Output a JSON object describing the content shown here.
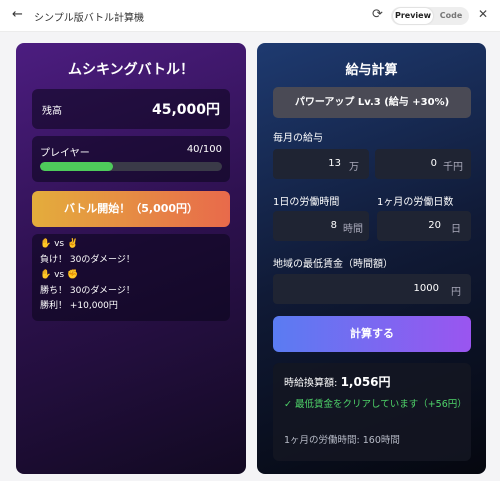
{
  "topbar": {
    "back_icon": "←",
    "title": "シンプル版バトル計算機",
    "refresh_icon": "⟳",
    "toggle": {
      "preview": "Preview",
      "code": "Code"
    },
    "close_icon": "✕"
  },
  "battle": {
    "title": "ムシキングバトル！",
    "balance_label": "残高",
    "balance_value": "45,000円",
    "player_label": "プレイヤー",
    "player_hp": "40/100",
    "player_hp_fraction": 0.4,
    "hp_bar_color": "#4ecb5b",
    "start_button": "バトル開始！（5,000円）",
    "log": [
      "✋ vs ✌️",
      "負け！ 30のダメージ！",
      "✋ vs ✊",
      "勝ち！ 30のダメージ！",
      "勝利！ +10,000円"
    ]
  },
  "salary": {
    "title": "給与計算",
    "power_up_button": "パワーアップ Lv.3 (給与 +30%)",
    "monthly_salary_label": "毎月の給与",
    "monthly_man_value": "13",
    "monthly_man_unit": "万",
    "monthly_sen_value": "0",
    "monthly_sen_unit": "千円",
    "daily_hours_label": "1日の労働時間",
    "daily_hours_value": "8",
    "daily_hours_unit": "時間",
    "monthly_days_label": "1ヶ月の労働日数",
    "monthly_days_value": "20",
    "monthly_days_unit": "日",
    "min_wage_label": "地域の最低賃金（時間額）",
    "min_wage_value": "1000",
    "min_wage_unit": "円",
    "calc_button": "計算する",
    "result_label": "時給換算額:",
    "result_value": "1,056円",
    "result_ok": "✓ 最低賃金をクリアしています（+56円）",
    "result_hours": "1ヶ月の労働時間: 160時間",
    "ok_color": "#4fd56a"
  }
}
